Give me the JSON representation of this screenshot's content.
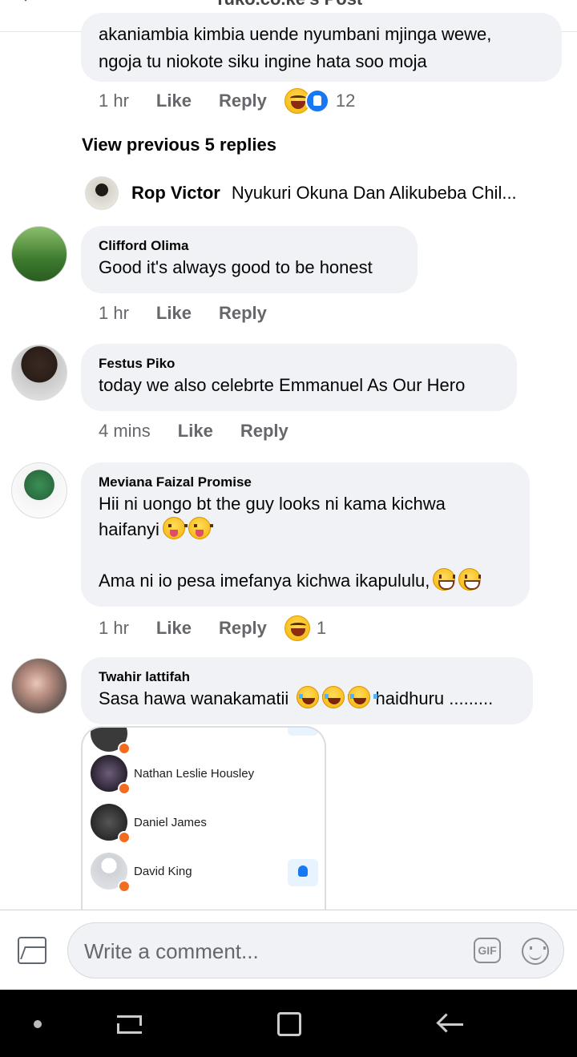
{
  "header": {
    "title": "Tuko.co.ke's Post"
  },
  "top_comment": {
    "text": "akaniambia kimbia uende nyumbani mjinga wewe,\nngoja tu niokote siku ingine hata soo moja",
    "time": "1 hr",
    "like_label": "Like",
    "reply_label": "Reply",
    "reaction_count": "12"
  },
  "view_previous": "View previous 5 replies",
  "reply_preview": {
    "name": "Rop Victor",
    "text": "Nyukuri Okuna Dan Alikubeba Chil..."
  },
  "comments": [
    {
      "name": "Clifford Olima",
      "text": "Good it's always good to be honest",
      "time": "1 hr",
      "like_label": "Like",
      "reply_label": "Reply"
    },
    {
      "name": "Festus Piko",
      "text": "today we also celebrte Emmanuel As Our Hero",
      "time": "4 mins",
      "like_label": "Like",
      "reply_label": "Reply"
    },
    {
      "name": "Meviana Faizal Promise",
      "line1": "Hii ni uongo bt the guy looks ni kama kichwa",
      "line2": "haifanyi",
      "line3": "Ama ni io pesa imefanya kichwa ikapululu,",
      "time": "1 hr",
      "like_label": "Like",
      "reply_label": "Reply",
      "reaction_count": "1"
    },
    {
      "name": "Twahir lattifah",
      "text_before": "Sasa hawa wanakamatii",
      "text_after": "haidhuru .........",
      "time": "",
      "like_label": "",
      "reply_label": ""
    }
  ],
  "attachment": {
    "people": [
      "Nathan Leslie Housley",
      "Daniel James",
      "David King"
    ]
  },
  "composer": {
    "placeholder": "Write a comment...",
    "gif_label": "GIF"
  }
}
